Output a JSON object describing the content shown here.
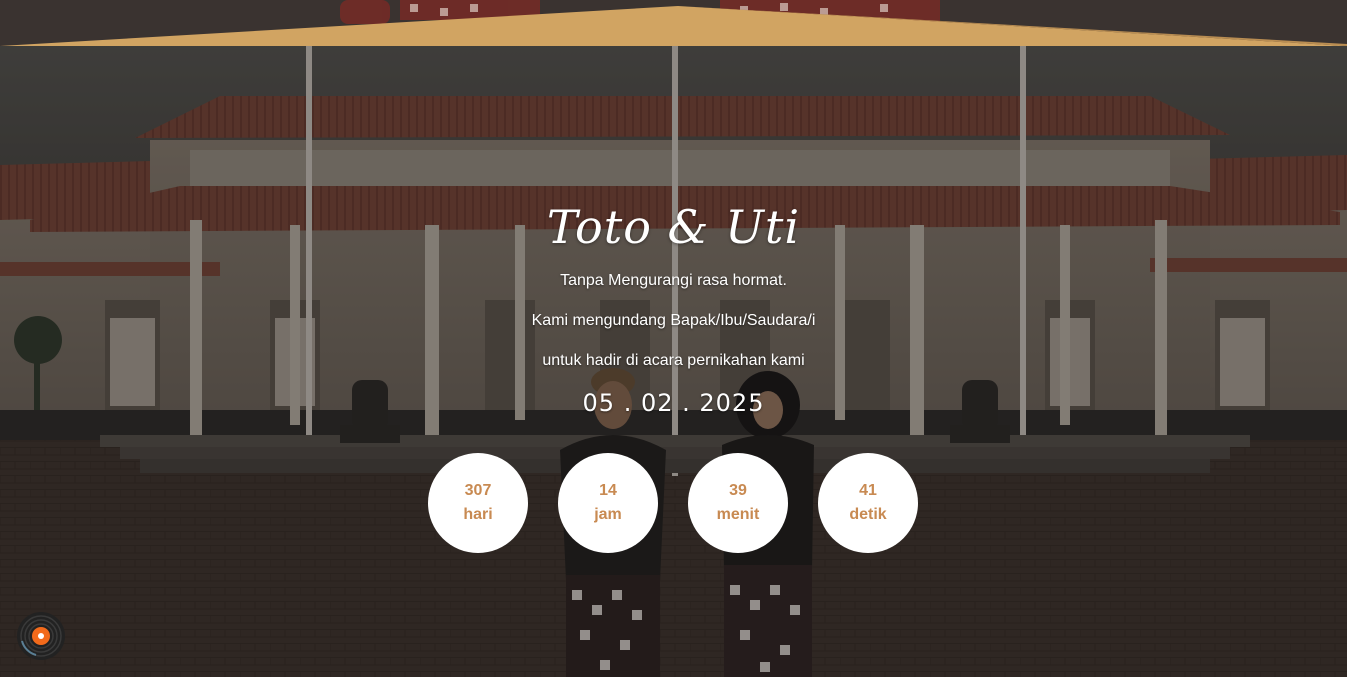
{
  "theme": {
    "accent": "#c88a52",
    "gold": "#d1a462"
  },
  "hero": {
    "title": "Toto & Uti",
    "lines": [
      "Tanpa Mengurangi rasa hormat.",
      "Kami mengundang Bapak/Ibu/Saudara/i",
      "untuk hadir di acara pernikahan kami"
    ],
    "date": "05 . 02 . 2025"
  },
  "countdown": [
    {
      "value": "307",
      "unit": "hari"
    },
    {
      "value": "14",
      "unit": "jam"
    },
    {
      "value": "39",
      "unit": "menit"
    },
    {
      "value": "41",
      "unit": "detik"
    }
  ],
  "music": {
    "icon": "vinyl-record-icon"
  }
}
